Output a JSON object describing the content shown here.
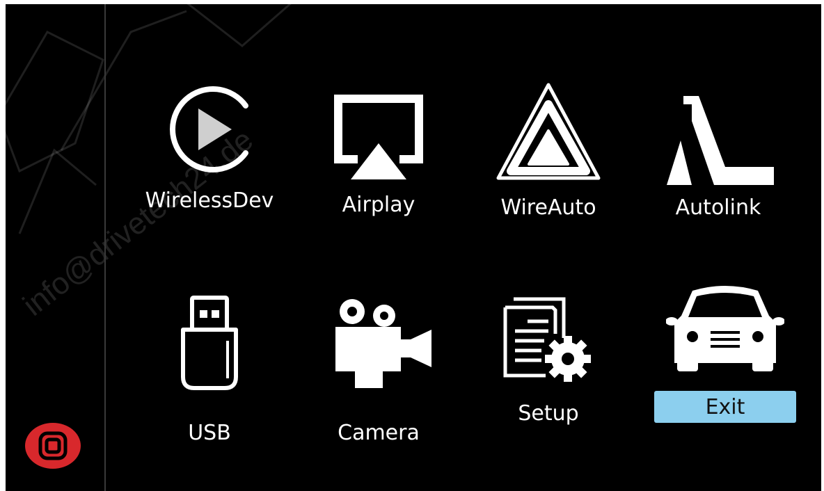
{
  "apps": {
    "wirelessdev": "WirelessDev",
    "airplay": "Airplay",
    "wireauto": "WireAuto",
    "autolink": "Autolink",
    "usb": "USB",
    "camera": "Camera",
    "setup": "Setup",
    "exit": "Exit"
  },
  "watermark": "info@drivetech24.de",
  "icons": {
    "wirelessdev": "play-circle-icon",
    "airplay": "airplay-icon",
    "wireauto": "android-auto-icon",
    "autolink": "autolink-icon",
    "usb": "usb-icon",
    "camera": "video-camera-icon",
    "setup": "document-gear-icon",
    "exit": "car-icon",
    "home": "home-icon"
  },
  "colors": {
    "background": "#000000",
    "foreground": "#ffffff",
    "exit_button": "#8ccfee",
    "home_button": "#d8282c"
  }
}
